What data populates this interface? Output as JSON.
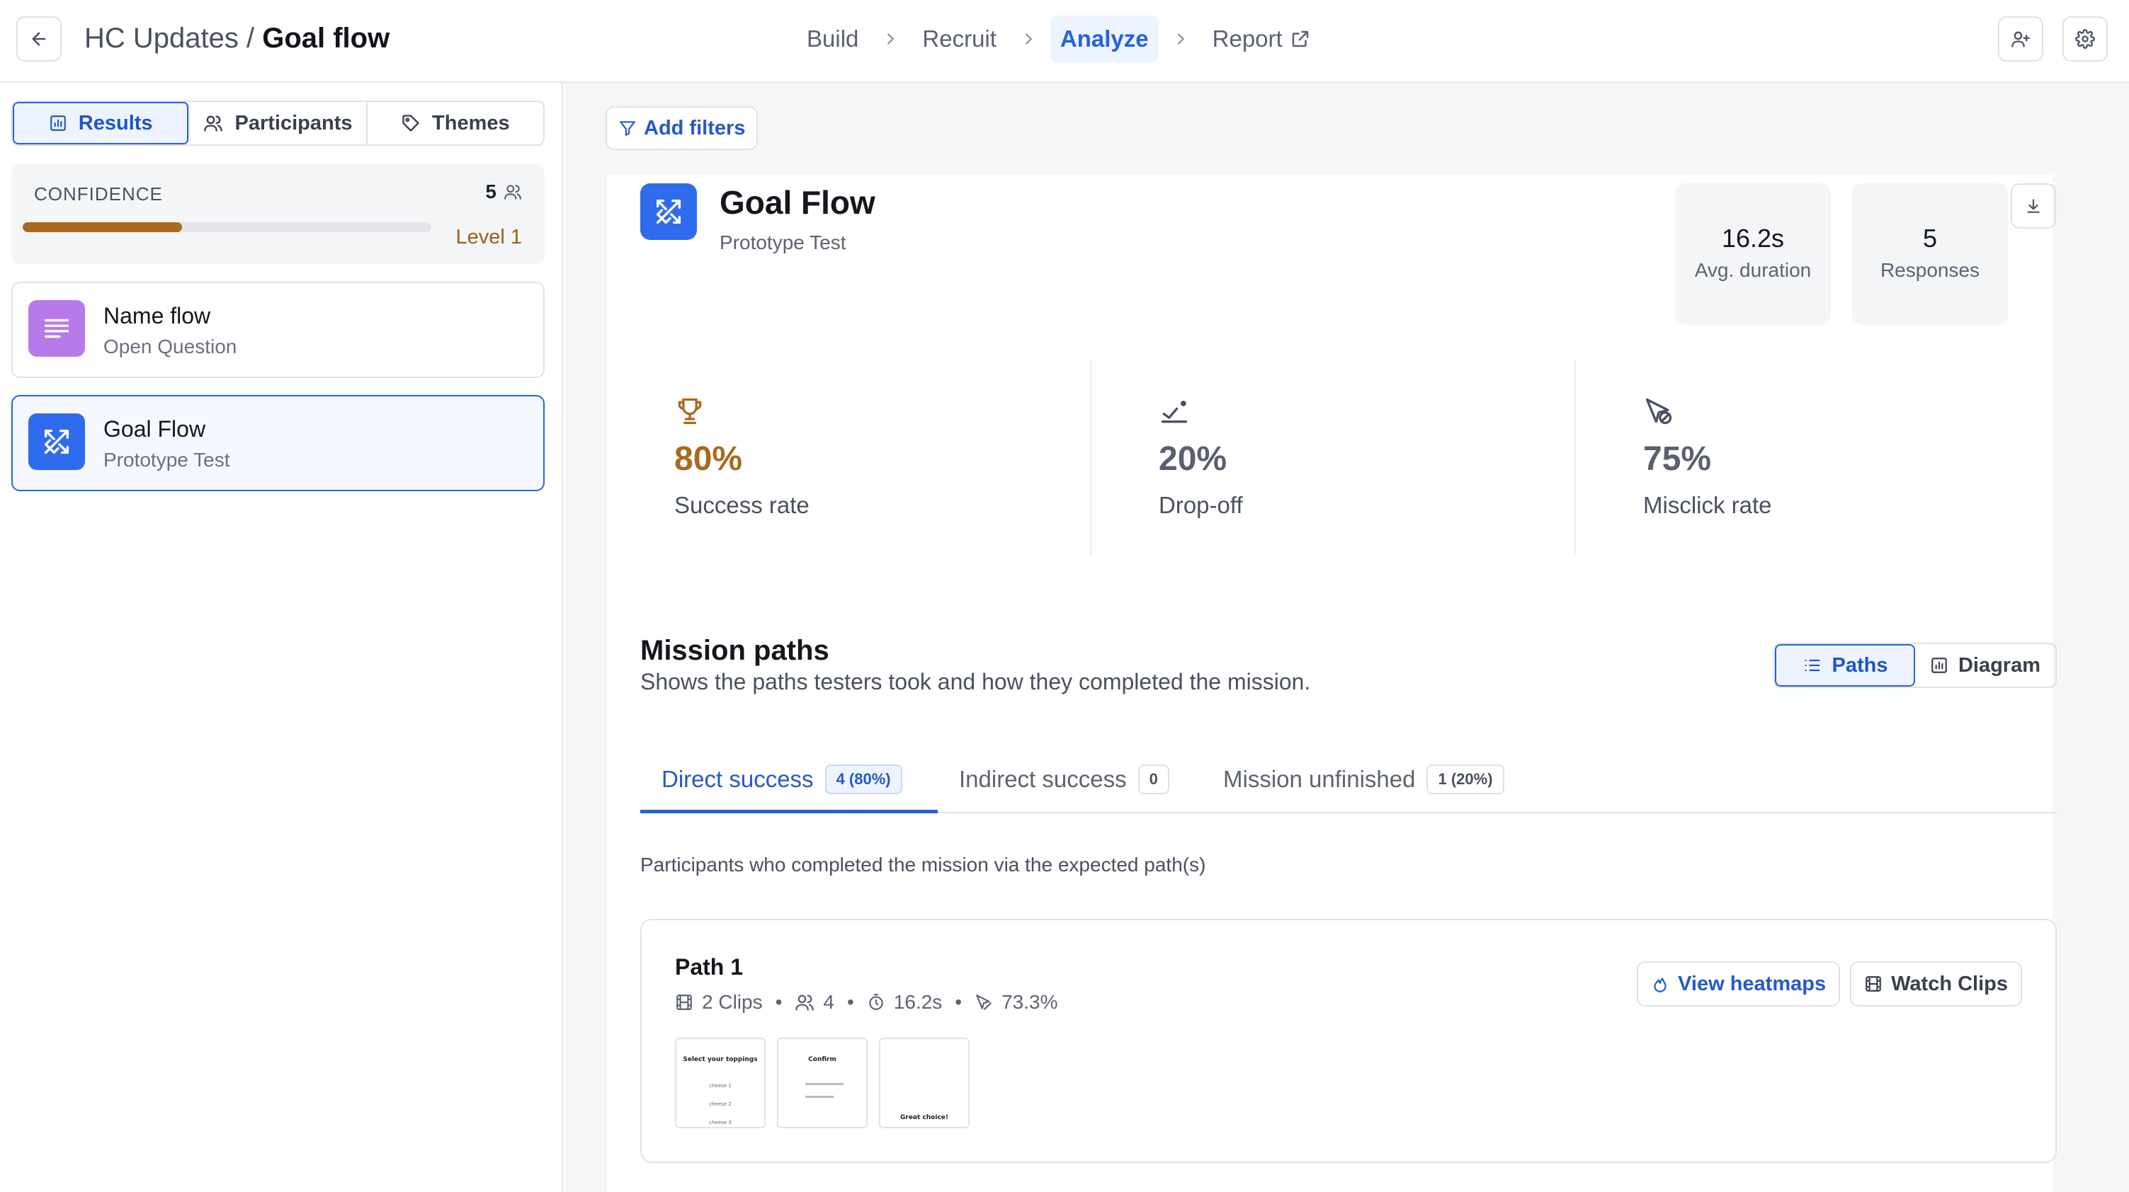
{
  "header": {
    "project": "HC Updates",
    "separator": " / ",
    "current": "Goal flow",
    "steps": [
      {
        "label": "Build"
      },
      {
        "label": "Recruit"
      },
      {
        "label": "Analyze"
      },
      {
        "label": "Report"
      }
    ],
    "active_step": "Analyze"
  },
  "sidebar": {
    "tabs": [
      {
        "label": "Results",
        "icon": "bar-chart-icon"
      },
      {
        "label": "Participants",
        "icon": "users-icon"
      },
      {
        "label": "Themes",
        "icon": "tag-icon"
      }
    ],
    "confidence": {
      "title": "CONFIDENCE",
      "count": "5",
      "level": "Level 1",
      "progress": 0.39
    },
    "questions": [
      {
        "title": "Name flow",
        "type": "Open Question",
        "icon": "text-lines-icon",
        "color": "#b77ae8"
      },
      {
        "title": "Goal Flow",
        "type": "Prototype Test",
        "icon": "prototype-icon",
        "color": "#2f6bed"
      }
    ]
  },
  "main": {
    "add_filters": "Add filters",
    "title": "Goal Flow",
    "subtitle": "Prototype Test",
    "stats": [
      {
        "value": "16.2s",
        "label": "Avg. duration"
      },
      {
        "value": "5",
        "label": "Responses"
      }
    ],
    "metrics": [
      {
        "value": "80%",
        "label": "Success rate",
        "icon": "trophy-icon",
        "color": "#a86a1f"
      },
      {
        "value": "20%",
        "label": "Drop-off",
        "icon": "drop-off-icon",
        "color": "#5a6070"
      },
      {
        "value": "75%",
        "label": "Misclick rate",
        "icon": "misclick-icon",
        "color": "#5a6070"
      }
    ],
    "mission_paths": {
      "title": "Mission paths",
      "subtitle": "Shows the paths testers took and how they completed the mission.",
      "views": [
        {
          "label": "Paths"
        },
        {
          "label": "Diagram"
        }
      ],
      "tabs": [
        {
          "label": "Direct success",
          "badge": "4 (80%)"
        },
        {
          "label": "Indirect success",
          "badge": "0"
        },
        {
          "label": "Mission unfinished",
          "badge": "1 (20%)"
        }
      ],
      "description": "Participants who completed the mission via the expected path(s)",
      "paths": [
        {
          "title": "Path 1",
          "clips": "2 Clips",
          "participants": "4",
          "duration": "16.2s",
          "misclick": "73.3%",
          "view_heatmaps": "View heatmaps",
          "watch_clips": "Watch Clips",
          "screens": [
            {
              "heading": "Select your toppings",
              "lines": [
                "cheese 1",
                "cheese 2",
                "cheese 3"
              ]
            },
            {
              "heading": "Confirm",
              "lines": [
                "",
                ""
              ]
            },
            {
              "heading": "",
              "footer": "Great choice!"
            }
          ]
        }
      ]
    }
  },
  "colors": {
    "accent": "#2563d9",
    "confidence_bar": "#a86a1f",
    "success": "#a86a1f"
  }
}
